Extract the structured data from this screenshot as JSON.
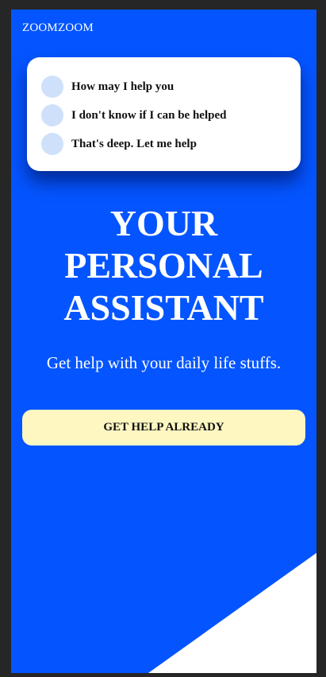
{
  "brand": {
    "name": "ZOOMZOOM"
  },
  "chat": {
    "messages": [
      {
        "text": "How may I help you"
      },
      {
        "text": "I don't know if I can be helped"
      },
      {
        "text": "That's deep. Let me help"
      }
    ]
  },
  "hero": {
    "title_lines": [
      "YOUR",
      "PERSONAL",
      "ASSISTANT"
    ],
    "subtitle": "Get help with your daily life stuffs.",
    "cta_label": "GET HELP ALREADY"
  },
  "colors": {
    "background": "#0455ff",
    "card": "#ffffff",
    "avatar": "#cfe0fb",
    "cta": "#fff7c2",
    "outer_frame": "#262626"
  }
}
